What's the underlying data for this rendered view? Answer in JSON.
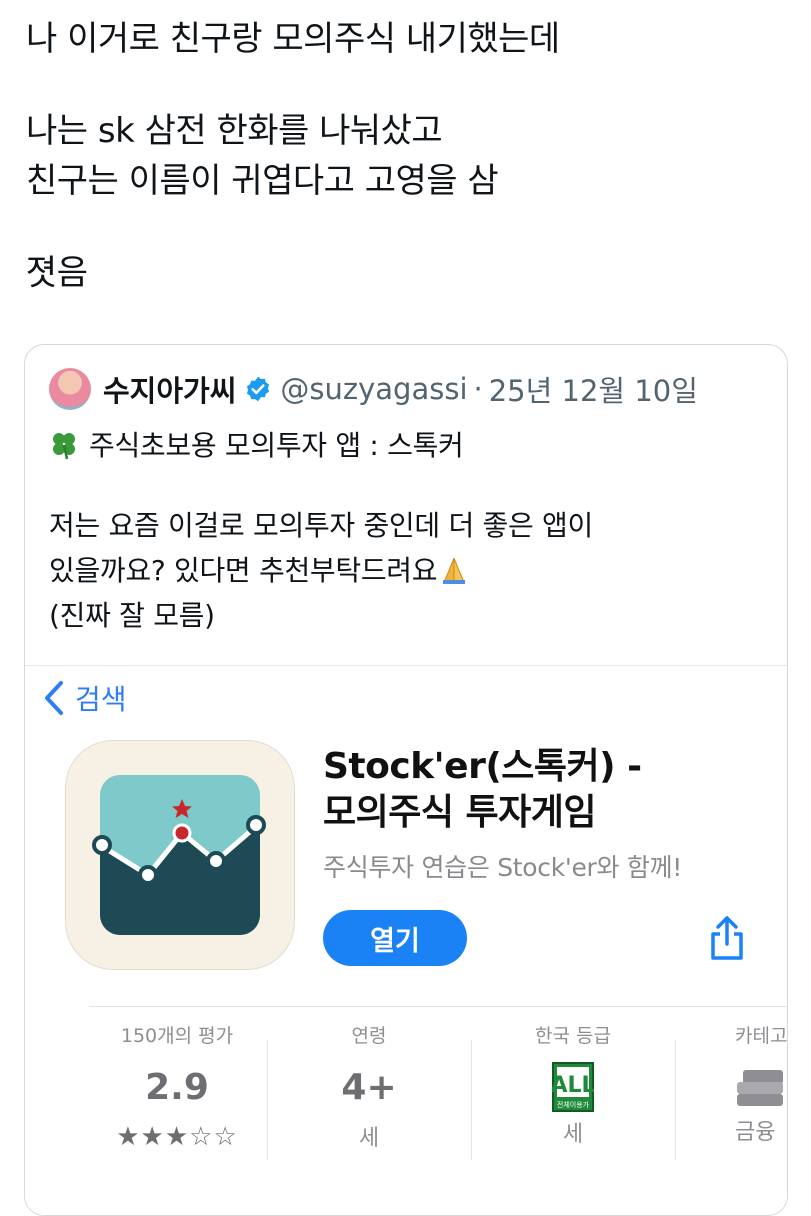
{
  "tweet": {
    "lines": [
      "나 이거로 친구랑 모의주식 내기했는데",
      "나는 sk 삼전 한화를 나눠샀고",
      "친구는 이름이 귀엽다고 고영을 삼",
      "졋음"
    ]
  },
  "quoted_tweet": {
    "display_name": "수지아가씨",
    "handle": "@suzyagassi",
    "separator": "·",
    "date": "25년 12월 10일",
    "title_line": "주식초보용 모의투자 앱 : 스톡커",
    "body_lines": [
      "저는 요즘 이걸로 모의투자 중인데 더 좋은 앱이",
      "있을까요? 있다면 추천부탁드려요",
      "(진짜 잘 모름)"
    ],
    "icons": {
      "title": "four-leaf-clover-icon",
      "body": "folded-hands-icon",
      "verified": "verified-badge-icon"
    }
  },
  "app_store": {
    "back_label": "검색",
    "app_title_lines": [
      "Stock'er(스톡커) -",
      "모의주식 투자게임"
    ],
    "subtitle": "주식투자 연습은 Stock'er와 함께!",
    "open_label": "열기",
    "accent_color": "#1a82f5",
    "stats": {
      "ratings": {
        "label": "150개의 평가",
        "value": "2.9",
        "stars_filled": 3,
        "stars_total": 5,
        "stars_text": "★★★☆☆"
      },
      "age": {
        "label": "연령",
        "value": "4+",
        "sub": "세"
      },
      "korea_rating": {
        "label": "한국 등급",
        "badge": "전체이용가",
        "badge_letter": "ALL",
        "sub": "세"
      },
      "category": {
        "label": "카테고",
        "sub": "금융"
      }
    }
  }
}
